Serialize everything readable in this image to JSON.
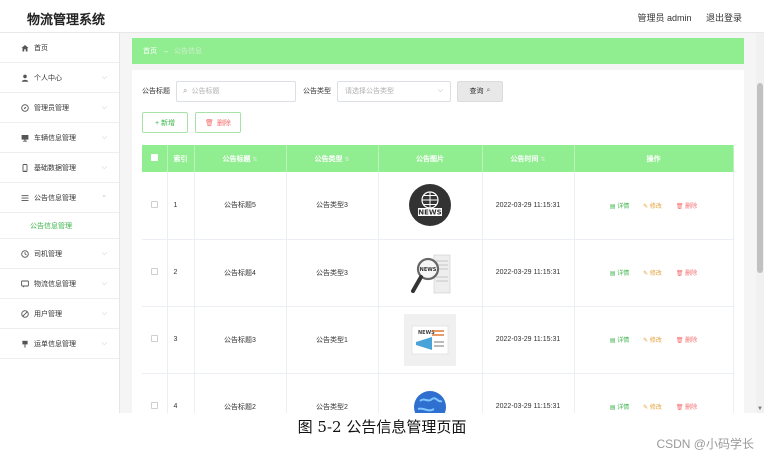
{
  "header": {
    "title": "物流管理系统",
    "user_label": "管理员 admin",
    "logout_label": "退出登录"
  },
  "sidebar": {
    "items": [
      {
        "label": "首页",
        "icon": "home-icon",
        "has_chevron": false
      },
      {
        "label": "个人中心",
        "icon": "user-icon",
        "has_chevron": true
      },
      {
        "label": "管理员管理",
        "icon": "compass-icon",
        "has_chevron": true
      },
      {
        "label": "车辆信息管理",
        "icon": "monitor-icon",
        "has_chevron": true
      },
      {
        "label": "基础数据管理",
        "icon": "phone-icon",
        "has_chevron": true
      },
      {
        "label": "公告信息管理",
        "icon": "list-icon",
        "has_chevron": true,
        "expanded": true
      },
      {
        "label": "司机管理",
        "icon": "clock-icon",
        "has_chevron": true
      },
      {
        "label": "物流信息管理",
        "icon": "message-icon",
        "has_chevron": true
      },
      {
        "label": "用户管理",
        "icon": "slash-circle-icon",
        "has_chevron": true
      },
      {
        "label": "运单信息管理",
        "icon": "pin-icon",
        "has_chevron": true
      }
    ],
    "submenu_active": "公告信息管理"
  },
  "breadcrumb": {
    "home": "首页",
    "separator": "→",
    "current": "公告信息"
  },
  "search": {
    "title_label": "公告标题",
    "title_placeholder": "公告标题",
    "type_label": "公告类型",
    "type_placeholder": "请选择公告类型",
    "query_label": "查询"
  },
  "actions": {
    "add_label": "+ 新增",
    "delete_label": "删除"
  },
  "table": {
    "headers": [
      "索引",
      "公告标题",
      "公告类型",
      "公告图片",
      "公告时间",
      "操作"
    ],
    "rows": [
      {
        "index": "1",
        "title": "公告标题5",
        "type": "公告类型3",
        "image": "news-globe",
        "time": "2022-03-29 11:15:31"
      },
      {
        "index": "2",
        "title": "公告标题4",
        "type": "公告类型3",
        "image": "news-magnifier",
        "time": "2022-03-29 11:15:31"
      },
      {
        "index": "3",
        "title": "公告标题3",
        "type": "公告类型1",
        "image": "news-megaphone",
        "time": "2022-03-29 11:15:31"
      },
      {
        "index": "4",
        "title": "公告标题2",
        "type": "公告类型2",
        "image": "news-earth",
        "time": "2022-03-29 11:15:31"
      }
    ],
    "ops": {
      "detail": "详情",
      "edit": "修改",
      "delete": "删除"
    }
  },
  "caption": "图 5-2 公告信息管理页面",
  "watermark": "CSDN @小码学长",
  "colors": {
    "accent_green": "#90ee90",
    "text_green": "#3bb54a",
    "warning": "#e6a23c",
    "danger": "#f56c6c"
  }
}
